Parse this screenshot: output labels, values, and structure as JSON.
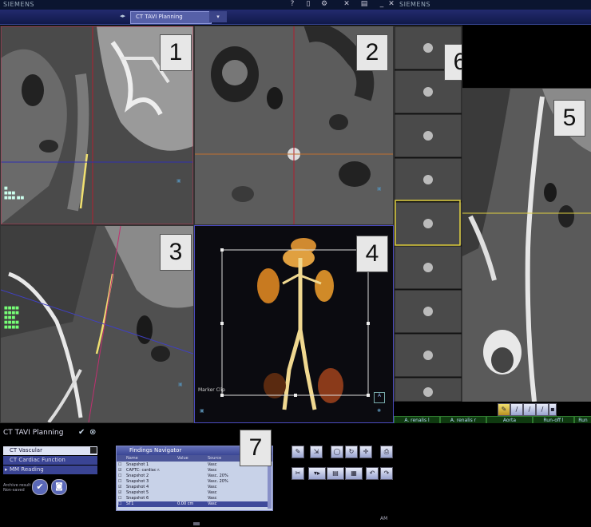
{
  "topbar": {
    "brand_left": "SIEMENS",
    "brand_right": "SIEMENS"
  },
  "tabbar": {
    "selected_tab": "CT TAVI Planning",
    "dropdown_icon": "chevron-down-icon"
  },
  "viewports": [
    {
      "id": 1,
      "number": "1",
      "kind": "curved-mpr-vessel"
    },
    {
      "id": 2,
      "number": "2",
      "kind": "cross-section"
    },
    {
      "id": 3,
      "number": "3",
      "kind": "oblique-mpr"
    },
    {
      "id": 4,
      "number": "4",
      "kind": "volume-rendering",
      "label": "Marker Clip"
    },
    {
      "id": 5,
      "number": "5",
      "kind": "stretched-vessel"
    },
    {
      "id": 6,
      "number": "6",
      "kind": "cross-section-strip"
    }
  ],
  "vessel_tabs": [
    "A. renalis l",
    "A. renalis r",
    "Aorta",
    "Run-off l",
    "Run"
  ],
  "workflow": {
    "title": "CT TAVI Planning",
    "items": [
      "CT Vascular",
      "CT Cardiac Function",
      "MM Reading"
    ],
    "archive_label": "Archive result",
    "archive_sub": "Non-saved"
  },
  "findings_navigator": {
    "number": "7",
    "title": "Findings Navigator",
    "columns": [
      "Name",
      "Value",
      "Source"
    ],
    "rows": [
      {
        "name": "Snapshot 1",
        "value": "",
        "source": "Vasc"
      },
      {
        "name": "CAPTC: cardiac r.",
        "value": "",
        "source": "Vasc"
      },
      {
        "name": "Snapshot 2",
        "value": "",
        "source": "Vasc. 20%"
      },
      {
        "name": "Snapshot 3",
        "value": "",
        "source": "Vasc. 20%"
      },
      {
        "name": "Snapshot 4",
        "value": "",
        "source": "Vasc"
      },
      {
        "name": "Snapshot 5",
        "value": "",
        "source": "Vasc"
      },
      {
        "name": "Snapshot 6",
        "value": "",
        "source": "Vasc"
      },
      {
        "name": "ST1",
        "value": "0.00 cm",
        "source": "Vasc"
      }
    ]
  },
  "status": {
    "bottom_right": "AM"
  }
}
